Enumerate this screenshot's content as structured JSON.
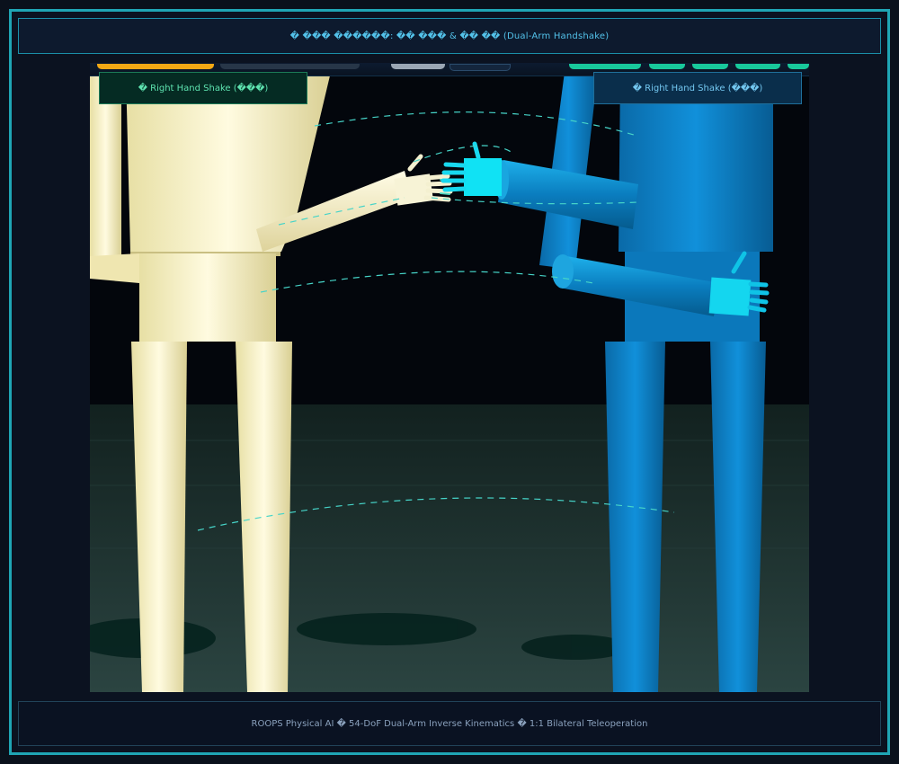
{
  "header": {
    "title": "� ��� ������: �� ��� & �� �� (Dual-Arm Handshake)"
  },
  "labels": {
    "left_robot": "� Right Hand Shake (���)",
    "right_robot": "� Right Hand Shake (���)"
  },
  "footer": {
    "text": "ROOPS Physical AI � 54-DoF Dual-Arm Inverse Kinematics � 1:1 Bilateral Teleoperation"
  },
  "colors": {
    "frame_accent": "#1fa5b4",
    "left_robot": "#f3eec3",
    "right_robot": "#0b7fc8",
    "trajectory": "#46d4c8",
    "hand_highlight": "#11e6f2"
  },
  "icons": {
    "title": "handshake-icon",
    "labels": "hand-icon"
  }
}
